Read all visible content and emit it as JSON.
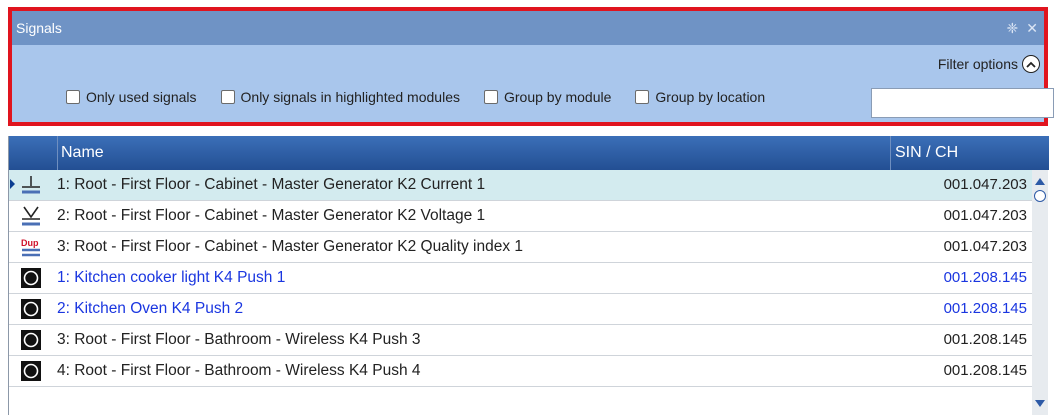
{
  "panel": {
    "title": "Signals",
    "pin_glyph": "❈",
    "close_glyph": "✕",
    "filter_label": "Filter options",
    "options": [
      {
        "label": "Only used signals",
        "checked": false
      },
      {
        "label": "Only signals in highlighted modules",
        "checked": false
      },
      {
        "label": "Group by module",
        "checked": false
      },
      {
        "label": "Group by location",
        "checked": false
      }
    ],
    "search_value": ""
  },
  "grid": {
    "columns": [
      "Name",
      "SIN / CH"
    ],
    "rows": [
      {
        "name": "1: Root - First Floor - Cabinet - Master Generator K2 Current 1",
        "sin": "001.047.203",
        "icon": "current-icon",
        "selected": true
      },
      {
        "name": "2: Root - First Floor - Cabinet - Master Generator K2 Voltage 1",
        "sin": "001.047.203",
        "icon": "voltage-icon"
      },
      {
        "name": "3: Root - First Floor - Cabinet - Master Generator K2 Quality index 1",
        "sin": "001.047.203",
        "icon": "dup-icon"
      },
      {
        "name": "1: Kitchen cooker light K4 Push 1",
        "sin": "001.208.145",
        "icon": "push-button-icon",
        "blue": true
      },
      {
        "name": "2: Kitchen Oven K4 Push 2",
        "sin": "001.208.145",
        "icon": "push-button-icon",
        "blue": true
      },
      {
        "name": "3: Root - First Floor - Bathroom - Wireless K4 Push 3",
        "sin": "001.208.145",
        "icon": "push-button-icon"
      },
      {
        "name": "4: Root - First Floor - Bathroom - Wireless K4 Push 4",
        "sin": "001.208.145",
        "icon": "push-button-icon"
      }
    ]
  },
  "colors": {
    "border_red": "#e0141e",
    "link_blue": "#1a36e0",
    "header_blue": "#2a5aa0"
  }
}
